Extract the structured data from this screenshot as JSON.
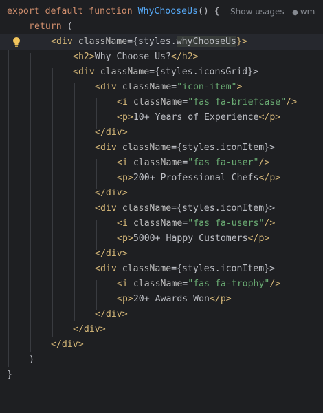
{
  "editor": {
    "usages_hint": "Show usages",
    "author_hint": "wm",
    "lines": [
      [
        "export",
        " ",
        "default",
        " ",
        "function",
        " ",
        "WhyChooseUs",
        "() {"
      ],
      [
        "return",
        " ("
      ],
      [
        "<div ",
        "className",
        "={styles.",
        "whyChooseUs",
        "}>"
      ],
      [
        "<h2>",
        "Why Choose Us?",
        "</h2>"
      ],
      [
        "<div ",
        "className",
        "={styles.iconsGrid}>"
      ],
      [
        "<div ",
        "className",
        "=",
        "\"icon-item\"",
        ">"
      ],
      [
        "<i ",
        "className",
        "=",
        "\"fas fa-briefcase\"",
        "/>"
      ],
      [
        "<p>",
        "10+ Years of Experience",
        "</p>"
      ],
      [
        "</div>"
      ],
      [
        "<div ",
        "className",
        "={styles.iconItem}>"
      ],
      [
        "<i ",
        "className",
        "=",
        "\"fas fa-user\"",
        "/>"
      ],
      [
        "<p>",
        "200+ Professional Chefs",
        "</p>"
      ],
      [
        "</div>"
      ],
      [
        "<div ",
        "className",
        "={styles.iconItem}>"
      ],
      [
        "<i ",
        "className",
        "=",
        "\"fas fa-users\"",
        "/>"
      ],
      [
        "<p>",
        "5000+ Happy Customers",
        "</p>"
      ],
      [
        "</div>"
      ],
      [
        "<div ",
        "className",
        "={styles.iconItem}>"
      ],
      [
        "<i ",
        "className",
        "=",
        "\"fas fa-trophy\"",
        "/>"
      ],
      [
        "<p>",
        "20+ Awards Won",
        "</p>"
      ],
      [
        "</div>"
      ],
      [
        "</div>"
      ],
      [
        "</div>"
      ],
      [
        ")"
      ],
      [
        "}"
      ]
    ]
  },
  "colors": {
    "background": "#1e1f22",
    "keyword": "#cf8e6d",
    "function": "#56a8f5",
    "tag": "#d5b778",
    "string": "#6aab73",
    "text": "#bcbec4",
    "hint": "#868a91"
  }
}
